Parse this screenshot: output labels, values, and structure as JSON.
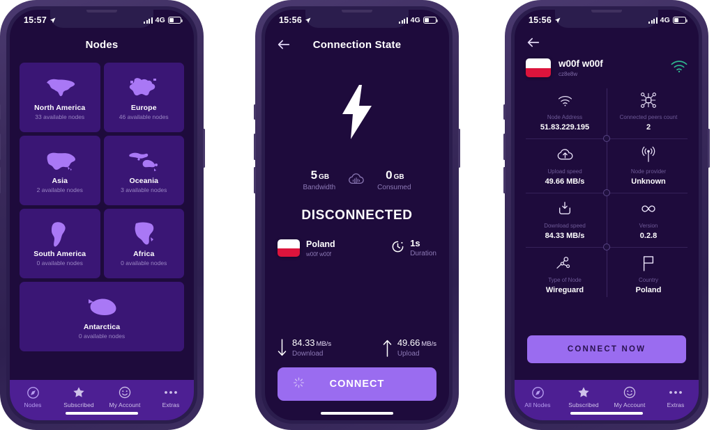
{
  "theme": {
    "phone_frame": "#3b2b5c",
    "screen_bg": "#1e0b3c",
    "card_bg": "#3a1675",
    "accent": "#9a6cf0",
    "tabbar_bg": "#4d1f93",
    "muted_text": "#8d7ab6",
    "wifi_green": "#2fb88f"
  },
  "phones": [
    {
      "id": "nodes-screen",
      "status_bar": {
        "time": "15:57",
        "network": "4G",
        "location_icon": "location-arrow-icon",
        "signal_icon": "signal-bars-icon",
        "battery_icon": "battery-icon"
      },
      "header": {
        "title": "Nodes",
        "has_back": false
      },
      "continents": [
        {
          "name": "North America",
          "nodes": "33 available nodes",
          "icon": "map-north-america-icon"
        },
        {
          "name": "Europe",
          "nodes": "46 available nodes",
          "icon": "map-europe-icon"
        },
        {
          "name": "Asia",
          "nodes": "2 available nodes",
          "icon": "map-asia-icon"
        },
        {
          "name": "Oceania",
          "nodes": "3 available nodes",
          "icon": "map-oceania-icon"
        },
        {
          "name": "South America",
          "nodes": "0 available nodes",
          "icon": "map-south-america-icon"
        },
        {
          "name": "Africa",
          "nodes": "0 available nodes",
          "icon": "map-africa-icon"
        },
        {
          "name": "Antarctica",
          "nodes": "0 available nodes",
          "icon": "map-antarctica-icon"
        }
      ],
      "tabs": [
        {
          "label": "Nodes",
          "icon": "compass-icon",
          "active": true
        },
        {
          "label": "Subscribed",
          "icon": "star-icon",
          "active": false
        },
        {
          "label": "My Account",
          "icon": "smiley-icon",
          "active": false
        },
        {
          "label": "Extras",
          "icon": "ellipsis-icon",
          "active": false
        }
      ]
    },
    {
      "id": "connection-state-screen",
      "status_bar": {
        "time": "15:56",
        "network": "4G",
        "location_icon": "location-arrow-icon",
        "signal_icon": "signal-bars-icon",
        "battery_icon": "battery-icon"
      },
      "header": {
        "title": "Connection State",
        "has_back": true,
        "back_icon": "arrow-left-icon"
      },
      "hero_icon": "lightning-bolt-icon",
      "bandwidth": {
        "total_value": "5",
        "total_unit": "GB",
        "total_label": "Bandwidth",
        "divider_icon": "cloud-bandwidth-icon",
        "consumed_value": "0",
        "consumed_unit": "GB",
        "consumed_label": "Consumed"
      },
      "connection_state": "DISCONNECTED",
      "country": {
        "name": "Poland",
        "node": "w00f w00f",
        "flag": "poland-flag-icon"
      },
      "duration": {
        "value": "1s",
        "label": "Duration",
        "icon": "clock-icon"
      },
      "speeds": [
        {
          "value": "84.33",
          "unit": "MB/s",
          "label": "Download",
          "icon": "arrow-down-icon"
        },
        {
          "value": "49.66",
          "unit": "MB/s",
          "label": "Upload",
          "icon": "arrow-up-icon"
        }
      ],
      "connect_button": {
        "label": "CONNECT",
        "spinner_icon": "spinner-icon"
      }
    },
    {
      "id": "node-details-screen",
      "status_bar": {
        "time": "15:56",
        "network": "4G",
        "location_icon": "location-arrow-icon",
        "signal_icon": "signal-bars-icon",
        "battery_icon": "battery-icon"
      },
      "header": {
        "has_back": true,
        "back_icon": "arrow-left-icon"
      },
      "node": {
        "name": "w00f w00f",
        "id": "cz8e8w",
        "flag": "poland-flag-icon",
        "status_icon": "wifi-icon"
      },
      "stats": [
        {
          "label": "Node Address",
          "value": "51.83.229.195",
          "icon": "wifi-icon"
        },
        {
          "label": "Connected peers count",
          "value": "2",
          "icon": "peers-network-icon"
        },
        {
          "label": "Upload speed",
          "value": "49.66 MB/s",
          "icon": "cloud-upload-icon"
        },
        {
          "label": "Node provider",
          "value": "Unknown",
          "icon": "broadcast-tower-icon"
        },
        {
          "label": "Download speed",
          "value": "84.33 MB/s",
          "icon": "download-tray-icon"
        },
        {
          "label": "Version",
          "value": "0.2.8",
          "icon": "infinity-icon"
        },
        {
          "label": "Type of Node",
          "value": "Wireguard",
          "icon": "node-graph-icon"
        },
        {
          "label": "Country",
          "value": "Poland",
          "icon": "flag-icon"
        }
      ],
      "connect_button": {
        "label": "CONNECT NOW"
      },
      "tabs": [
        {
          "label": "All Nodes",
          "icon": "compass-icon",
          "active": true
        },
        {
          "label": "Subscribed",
          "icon": "star-icon",
          "active": false
        },
        {
          "label": "My Account",
          "icon": "smiley-icon",
          "active": false
        },
        {
          "label": "Extras",
          "icon": "ellipsis-icon",
          "active": false
        }
      ]
    }
  ]
}
